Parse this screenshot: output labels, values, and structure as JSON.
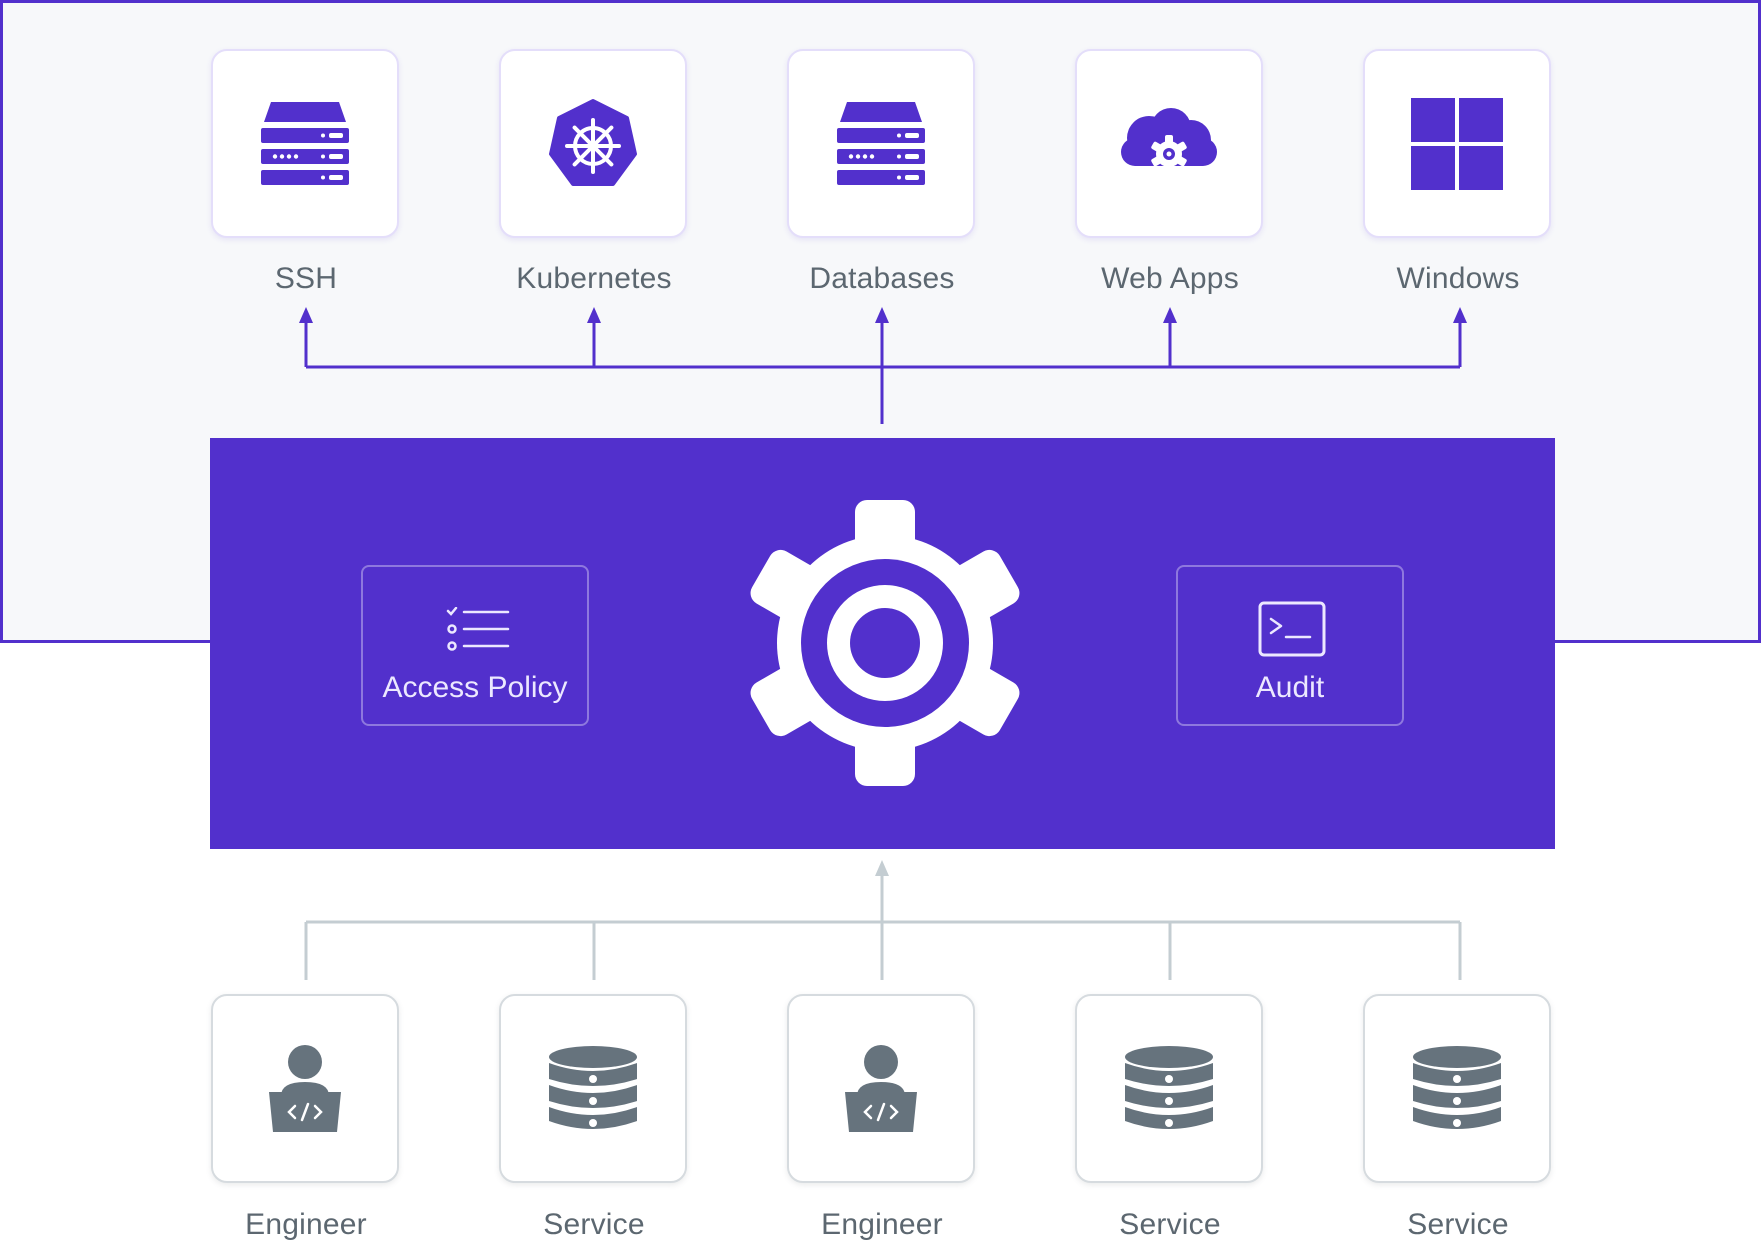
{
  "colors": {
    "accent": "#5230cc",
    "panel": "#f7f8fa",
    "client_gray": "#66737d",
    "connector_gray": "#c4cdd2"
  },
  "targets": [
    {
      "label": "SSH",
      "icon": "server-rack-icon"
    },
    {
      "label": "Kubernetes",
      "icon": "kubernetes-icon"
    },
    {
      "label": "Databases",
      "icon": "server-rack-icon"
    },
    {
      "label": "Web Apps",
      "icon": "cloud-gear-icon"
    },
    {
      "label": "Windows",
      "icon": "windows-icon"
    }
  ],
  "core": {
    "center_icon": "gear-icon",
    "access_policy": {
      "label": "Access Policy",
      "icon": "checklist-icon"
    },
    "audit": {
      "label": "Audit",
      "icon": "terminal-icon"
    }
  },
  "clients": [
    {
      "label": "Engineer",
      "icon": "engineer-laptop-icon"
    },
    {
      "label": "Service",
      "icon": "database-icon"
    },
    {
      "label": "Engineer",
      "icon": "engineer-laptop-icon"
    },
    {
      "label": "Service",
      "icon": "database-icon"
    },
    {
      "label": "Service",
      "icon": "database-icon"
    }
  ]
}
